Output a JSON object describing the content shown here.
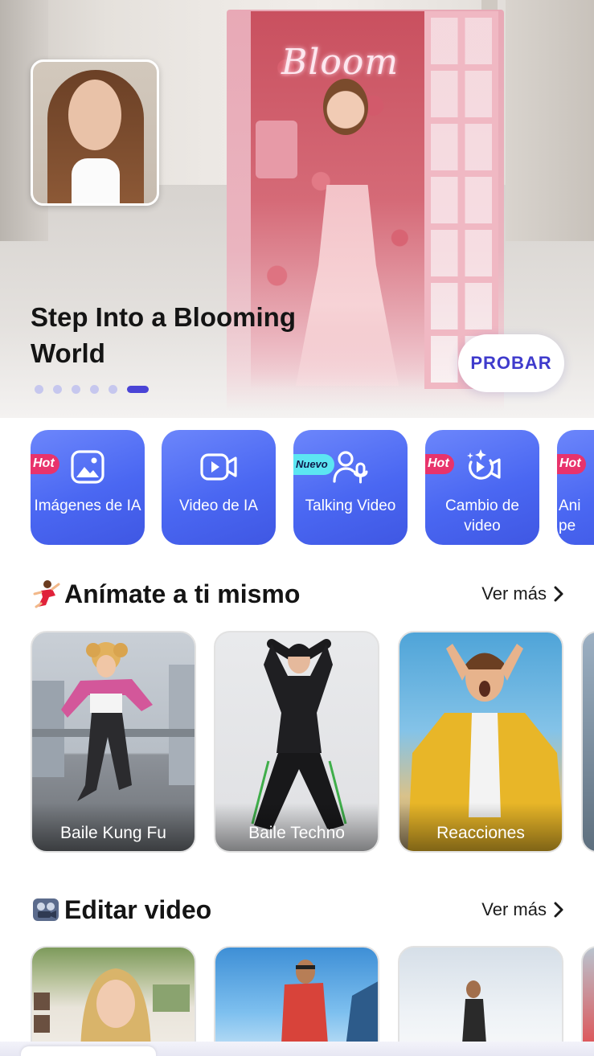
{
  "hero": {
    "title": "Step Into a Blooming World",
    "neon_sign": "Bloom",
    "cta_label": "PROBAR",
    "carousel_dots": 6,
    "active_dot_index": 5,
    "colors": {
      "accent": "#4a44d6",
      "cta_text": "#3f3bcc"
    }
  },
  "features": [
    {
      "label": "Imágenes de IA",
      "badge": "Hot",
      "icon": "image-icon"
    },
    {
      "label": "Video de IA",
      "badge": "",
      "icon": "video-camera-icon"
    },
    {
      "label": "Talking Video",
      "badge": "Nuevo",
      "icon": "person-mic-icon"
    },
    {
      "label": "Cambio de video",
      "badge": "Hot",
      "icon": "sparkle-video-icon"
    },
    {
      "label": "Ani pe",
      "badge": "Hot",
      "icon": ""
    }
  ],
  "sections": [
    {
      "title": "Anímate a ti mismo",
      "emoji": "dancer-emoji",
      "see_more": "Ver más",
      "cards": [
        {
          "label": "Baile Kung Fu"
        },
        {
          "label": "Baile Techno"
        },
        {
          "label": "Reacciones"
        }
      ]
    },
    {
      "title": "Editar video",
      "emoji": "film-projector-emoji",
      "see_more": "Ver más",
      "cards": [
        {
          "label": ""
        },
        {
          "label": ""
        },
        {
          "label": ""
        }
      ]
    }
  ]
}
